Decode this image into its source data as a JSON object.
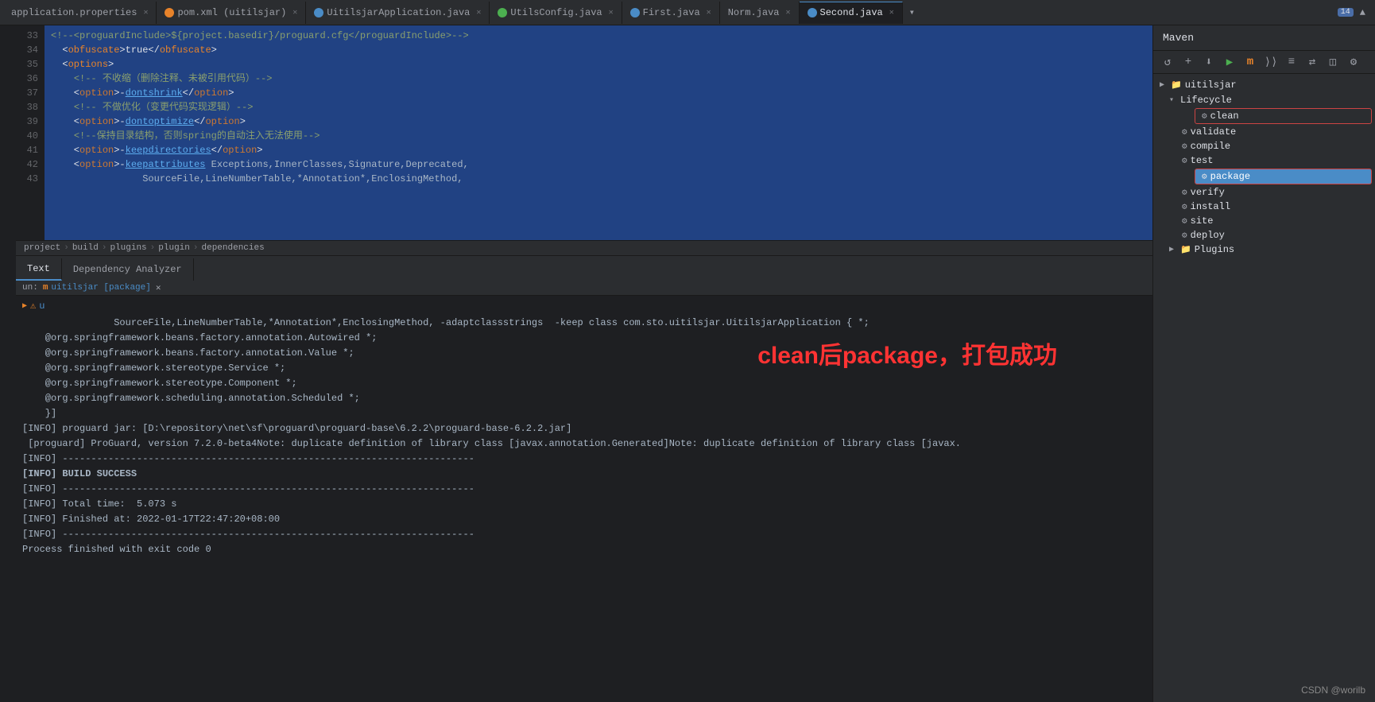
{
  "tabs": [
    {
      "id": "app-props",
      "label": "application.properties",
      "icon": "none",
      "color": "",
      "active": false
    },
    {
      "id": "pom-xml",
      "label": "pom.xml (uitilsjar)",
      "icon": "orange",
      "active": false
    },
    {
      "id": "uitilsjar-app",
      "label": "UitilsjarApplication.java",
      "icon": "blue",
      "active": false
    },
    {
      "id": "utils-config",
      "label": "UtilsConfig.java",
      "icon": "green",
      "active": false
    },
    {
      "id": "first-java",
      "label": "First.java",
      "icon": "blue",
      "active": false
    },
    {
      "id": "norm-java",
      "label": "Norm.java",
      "icon": "none",
      "active": false
    },
    {
      "id": "second-java",
      "label": "Second.java",
      "icon": "blue",
      "active": true
    }
  ],
  "editor": {
    "line_numbers": [
      "33",
      "34",
      "35",
      "36",
      "37",
      "38",
      "39",
      "40"
    ],
    "lines": [
      {
        "num": "33",
        "content": "<!--<proguardInclude>${project.basedir}/proguard.cfg</proguardInclude>-->",
        "type": "comment"
      },
      {
        "num": "34",
        "content": "  <obfuscate>true</obfuscate>",
        "type": "tag"
      },
      {
        "num": "35",
        "content": "  <options>",
        "type": "tag"
      },
      {
        "num": "36",
        "content": "    <!-- 不收缩（删除注释、未被引用代码）-->",
        "type": "cn-comment"
      },
      {
        "num": "37",
        "content": "    <option>-dontshrink</option>",
        "type": "option"
      },
      {
        "num": "38",
        "content": "    <!-- 不做优化（变更代码实现逻辑）-->",
        "type": "cn-comment"
      },
      {
        "num": "39",
        "content": "    <option>-dontoptimize</option>",
        "type": "option"
      },
      {
        "num": "40",
        "content": "    <!--保持目录结构，否则spring的自动注入无法使用-->",
        "type": "cn-comment"
      },
      {
        "num": "41",
        "content": "    <option>-keepdirectories</option>",
        "type": "option"
      },
      {
        "num": "42",
        "content": "    <option>-keepattributes Exceptions,InnerClasses,Signature,Deprecated,",
        "type": "option"
      },
      {
        "num": "43",
        "content": "                SourceFile,LineNumberTable,*Annotation*,EnclosingMethod,",
        "type": "value"
      }
    ]
  },
  "breadcrumb": {
    "items": [
      "project",
      "build",
      "plugins",
      "plugin",
      "dependencies"
    ]
  },
  "panel_tabs": [
    {
      "label": "Text",
      "active": true
    },
    {
      "label": "Dependency Analyzer",
      "active": false
    }
  ],
  "run_bar": {
    "label": "un:",
    "item_icon": "m",
    "item_text": "uitilsjar [package]"
  },
  "terminal": {
    "lines": [
      "                SourceFile,LineNumberTable,*Annotation*,EnclosingMethod, -adaptclassstrings  -keep class com.sto.uitilsjar.UitilsjarApplication { *;",
      "    @org.springframework.beans.factory.annotation.Autowired *;",
      "    @org.springframework.beans.factory.annotation.Value *;",
      "    @org.springframework.stereotype.Service *;",
      "    @org.springframework.stereotype.Component *;",
      "    @org.springframework.scheduling.annotation.Scheduled *;",
      "",
      "    }]",
      "",
      "[INFO] proguard jar: [D:\\repository\\net\\sf\\proguard\\proguard-base\\6.2.2\\proguard-base-6.2.2.jar]",
      " [proguard] ProGuard, version 7.2.0-beta4Note: duplicate definition of library class [javax.annotation.Generated]Note: duplicate definition of library class [javax.",
      "[INFO] ------------------------------------------------------------------------",
      "[INFO] BUILD SUCCESS",
      "[INFO] ------------------------------------------------------------------------",
      "[INFO] Total time:  5.073 s",
      "[INFO] Finished at: 2022-01-17T22:47:20+08:00",
      "[INFO] ------------------------------------------------------------------------",
      "",
      "Process finished with exit code 0"
    ]
  },
  "annotation": "clean后package，打包成功",
  "maven": {
    "title": "Maven",
    "toolbar_buttons": [
      "refresh",
      "add",
      "download",
      "play",
      "maven-m",
      "skip-tests",
      "unknown1",
      "unknown2",
      "unknown3",
      "settings"
    ],
    "tree": {
      "root": "uitilsjar",
      "children": [
        {
          "label": "Lifecycle",
          "expanded": true,
          "items": [
            {
              "label": "clean",
              "highlighted": true,
              "selected": false
            },
            {
              "label": "validate",
              "highlighted": false,
              "selected": false
            },
            {
              "label": "compile",
              "highlighted": false,
              "selected": false
            },
            {
              "label": "test",
              "highlighted": false,
              "selected": false
            },
            {
              "label": "package",
              "highlighted": true,
              "selected": true
            },
            {
              "label": "verify",
              "highlighted": false,
              "selected": false
            },
            {
              "label": "install",
              "highlighted": false,
              "selected": false
            },
            {
              "label": "site",
              "highlighted": false,
              "selected": false
            },
            {
              "label": "deploy",
              "highlighted": false,
              "selected": false
            }
          ]
        },
        {
          "label": "Plugins",
          "expanded": false,
          "items": []
        }
      ]
    }
  },
  "counter": "14",
  "watermark": "CSDN @worilb"
}
